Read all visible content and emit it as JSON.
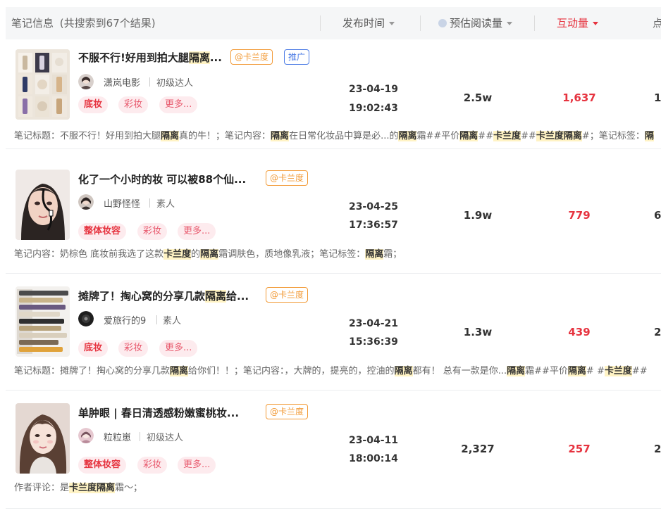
{
  "header": {
    "info_label": "笔记信息",
    "count_label": "(共搜索到67个结果)",
    "col_publish": "发布时间",
    "col_views": "预估阅读量",
    "col_engage": "互动量",
    "col_cut": "点"
  },
  "rows": [
    {
      "title": "不服不行!好用到拍大腿",
      "title_hl": "隔离",
      "title_tail": "...",
      "brand_tag": "@卡兰度",
      "ad_tag": "推广",
      "author": "潇岚电影",
      "level": "初级达人",
      "tags": [
        "底妆",
        "彩妆",
        "更多..."
      ],
      "date": "23-04-19",
      "time": "19:02:43",
      "views": "2.5w",
      "engage": "1,637",
      "cut": "1",
      "desc": [
        "笔记标题：不服不行！好用到拍大腿",
        "隔离",
        "真的牛！；笔记内容：",
        "隔离",
        "在日常化妆品中算是必...的",
        "隔离",
        "霜##平价",
        "隔离",
        "##",
        "卡兰度",
        "##",
        "卡兰度隔离",
        "#；笔记标签：",
        "隔"
      ]
    },
    {
      "title": "化了一个小时的妆 可以被88个仙...",
      "brand_tag": "@卡兰度",
      "author": "山野怪怪",
      "level": "素人",
      "tags": [
        "整体妆容",
        "彩妆",
        "更多..."
      ],
      "date": "23-04-25",
      "time": "17:36:57",
      "views": "1.9w",
      "engage": "779",
      "cut": "6",
      "desc": [
        "笔记内容：奶棕色 底妆前我选了这款",
        "卡兰度",
        "的",
        "隔离",
        "霜调肤色，质地像乳液；笔记标签：",
        "隔离",
        "霜；"
      ]
    },
    {
      "title": "摊牌了！掏心窝的分享几款",
      "title_hl": "隔离",
      "title_tail": "给...",
      "brand_tag": "@卡兰度",
      "author": "爱旅行的9",
      "level": "素人",
      "tags": [
        "底妆",
        "彩妆",
        "更多..."
      ],
      "date": "23-04-21",
      "time": "15:36:39",
      "views": "1.3w",
      "engage": "439",
      "cut": "2",
      "desc": [
        "笔记标题：摊牌了！掏心窝的分享几款",
        "隔离",
        "给你们！！；笔记内容：，大牌的，提亮的，控油的",
        "隔离",
        "都有！ 总有一款是你...",
        "隔离",
        "霜##平价",
        "隔离",
        "# #",
        "卡兰度",
        "##"
      ]
    },
    {
      "title": "单肿眼 | 春日清透感粉嫩蜜桃妆...",
      "brand_tag": "@卡兰度",
      "author": "粒粒崽",
      "level": "初级达人",
      "tags": [
        "整体妆容",
        "彩妆",
        "更多..."
      ],
      "date": "23-04-11",
      "time": "18:00:14",
      "views": "2,327",
      "engage": "257",
      "cut": "2",
      "desc": [
        "作者评论：是",
        "卡兰度隔离",
        "霜～；"
      ]
    }
  ]
}
